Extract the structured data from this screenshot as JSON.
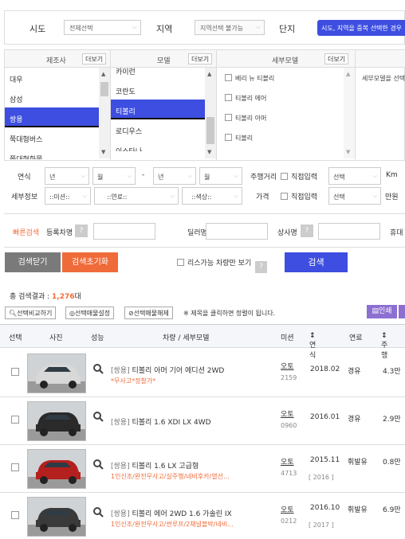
{
  "top": {
    "sido_label": "시도",
    "sido_value": "전체선택",
    "region_label": "지역",
    "region_value": "지역선택 불가능",
    "complex_label": "단지",
    "complex_notice": "시도, 지역을 중복 선택한 경우"
  },
  "filters": {
    "maker": {
      "header": "제조사",
      "more": "더보기",
      "items": [
        "대우",
        "삼성",
        "쌍용",
        "쭉대형버스",
        "쭉대형화물"
      ],
      "selected_index": 2
    },
    "model": {
      "header": "모델",
      "more": "더보기",
      "items": [
        "카이런",
        "코란도",
        "티볼리",
        "로디우스",
        "이스타나"
      ],
      "selected_index": 2
    },
    "submodel": {
      "header": "세부모델",
      "more": "더보기",
      "items": [
        "베리 뉴 티볼리",
        "티볼리 에어",
        "티볼리 아머",
        "티볼리"
      ]
    },
    "extra": {
      "hint": "세부모델을 선택"
    }
  },
  "details": {
    "year_label": "연식",
    "year_from": "년",
    "month_from": "월",
    "dash": "-",
    "year_to": "년",
    "month_to": "월",
    "mileage_label": "주행거리",
    "direct_input": "직접입력",
    "mileage_select": "선택",
    "km_unit": "Km",
    "info_label": "세부정보",
    "mission": "::미션::",
    "fuel": "::연료::",
    "color": "::색상::",
    "price_label": "가격",
    "price_direct": "직접입력",
    "price_select": "선택",
    "price_unit": "만원"
  },
  "quick": {
    "title": "빠른검색",
    "regno": "등록차명",
    "dealer": "딜러명",
    "company": "상사명",
    "phone": "휴대"
  },
  "actions": {
    "close": "검색닫기",
    "reset": "검색초기화",
    "lease_label": "리스가능 차량만 보기",
    "search": "검색"
  },
  "result": {
    "label": "총 검색결과 : ",
    "count": "1,276",
    "unit": "대",
    "compare": "선택비교하기",
    "settings": "선택매물설정",
    "release": "선택매물해제",
    "hint": "※ 제목을 클릭하면 정렬이 됩니다.",
    "print": "인쇄"
  },
  "table": {
    "headers": [
      "선택",
      "사진",
      "성능",
      "차량 / 세부모델",
      "미션",
      "연식",
      "연료",
      "주행"
    ],
    "rows": [
      {
        "maker": "[쌍용]",
        "title": "티볼리 아머 기어 에디션 2WD",
        "sub": "*무사고*정찰가*",
        "mission": "오토",
        "code": "2159",
        "year": "2018.02",
        "year2": "",
        "fuel": "경유",
        "km": "4.3만",
        "color": "#d8d8d8"
      },
      {
        "maker": "[쌍용]",
        "title": "티볼리 1.6 XDI LX 4WD",
        "sub": "",
        "mission": "오토",
        "code": "0960",
        "year": "2016.01",
        "year2": "",
        "fuel": "경유",
        "km": "2.9만",
        "color": "#2a2a2a"
      },
      {
        "maker": "[쌍용]",
        "title": "티볼리 1.6 LX 고급형",
        "sub": "1인신조/완전무사고/실주행/네비후카/열선...",
        "mission": "오토",
        "code": "4713",
        "year": "2015.11",
        "year2": "[ 2016 ]",
        "fuel": "휘발유",
        "km": "0.8만",
        "color": "#b3201e"
      },
      {
        "maker": "[쌍용]",
        "title": "티볼리 에어 2WD 1.6 가솔린 IX",
        "sub": "1인신조/완전무사고/썬루프/2채널블박/네비...",
        "mission": "오토",
        "code": "0212",
        "year": "2016.10",
        "year2": "[ 2017 ]",
        "fuel": "휘발유",
        "km": "6.9만",
        "color": "#3a3a3a"
      }
    ]
  }
}
